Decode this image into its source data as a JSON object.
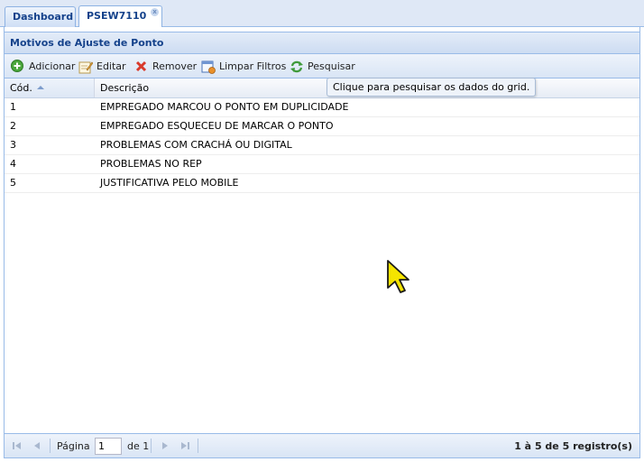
{
  "tabs": [
    {
      "label": "Dashboard",
      "active": false
    },
    {
      "label": "PSEW7110",
      "active": true,
      "close": "x"
    }
  ],
  "panel": {
    "title": "Motivos de Ajuste de Ponto"
  },
  "toolbar": {
    "add": "Adicionar",
    "edit": "Editar",
    "remove": "Remover",
    "clear_filters": "Limpar Filtros",
    "search": "Pesquisar"
  },
  "tooltip": "Clique para pesquisar os dados do grid.",
  "grid": {
    "columns": [
      "Cód.",
      "Descrição"
    ],
    "sort": {
      "column": "Cód.",
      "direction": "asc"
    },
    "rows": [
      {
        "code": "1",
        "description": "EMPREGADO MARCOU O PONTO EM DUPLICIDADE"
      },
      {
        "code": "2",
        "description": "EMPREGADO ESQUECEU DE MARCAR O PONTO"
      },
      {
        "code": "3",
        "description": "PROBLEMAS COM CRACHÁ OU DIGITAL"
      },
      {
        "code": "4",
        "description": "PROBLEMAS NO REP"
      },
      {
        "code": "5",
        "description": "JUSTIFICATIVA PELO MOBILE"
      }
    ]
  },
  "pager": {
    "page_label": "Página",
    "page_value": "1",
    "of_label": "de 1",
    "count": "1 à 5 de 5 registro(s)"
  },
  "colors": {
    "accent": "#15428b",
    "border": "#99bbe8",
    "header_bg": "#dfe8f6"
  },
  "icons": {
    "add": "add-circle-icon",
    "edit": "edit-pencil-icon",
    "remove": "red-x-icon",
    "clear_filters": "clear-filter-icon",
    "search": "refresh-arrows-icon"
  }
}
